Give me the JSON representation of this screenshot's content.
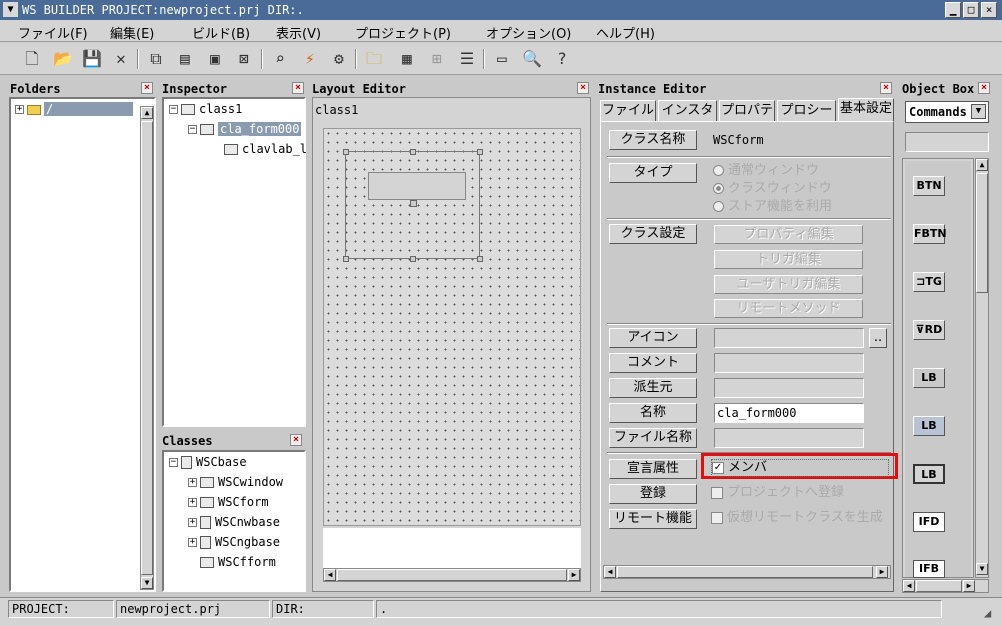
{
  "window": {
    "title": "WS BUILDER PROJECT:newproject.prj DIR:."
  },
  "menu": [
    "ファイル(F)",
    "編集(E)",
    "ビルド(B)",
    "表示(V)",
    "プロジェクト(P)",
    "オプション(O)",
    "ヘルプ(H)"
  ],
  "folders": {
    "title": "Folders",
    "root": "/"
  },
  "inspector": {
    "title": "Inspector",
    "items": [
      "class1",
      "cla_form000",
      "clavlab_l"
    ]
  },
  "classes": {
    "title": "Classes",
    "items": [
      "WSCbase",
      "WSCwindow",
      "WSCform",
      "WSCnwbase",
      "WSCngbase",
      "WSCfform"
    ]
  },
  "layout": {
    "title": "Layout Editor",
    "class_label": "class1"
  },
  "instance": {
    "title": "Instance Editor",
    "tabs": [
      "ファイル",
      "インスタ",
      "プロパテ",
      "プロシー",
      "基本設定"
    ],
    "class_name_label": "クラス名称",
    "class_name_value": "WSCform",
    "type_label": "タイプ",
    "type_options": [
      "通常ウィンドウ",
      "クラスウィンドウ",
      "ストア機能を利用"
    ],
    "type_selected": "クラスウィンドウ",
    "class_settings_label": "クラス設定",
    "class_settings_buttons": [
      "プロパティ編集",
      "トリガ編集",
      "ユーザトリガ編集",
      "リモートメソッド"
    ],
    "icon_label": "アイコン",
    "icon_btn": "..",
    "comment_label": "コメント",
    "derived_label": "派生元",
    "name_label": "名称",
    "name_value": "cla_form000",
    "filename_label": "ファイル名称",
    "decl_label": "宣言属性",
    "decl_check": "メンバ",
    "register_label": "登録",
    "register_check": "プロジェクトへ登録",
    "remote_label": "リモート機能",
    "remote_check": "仮想リモートクラスを生成"
  },
  "objectbox": {
    "title": "Object Box",
    "category": "Commands",
    "items": [
      "BTN",
      "FBTN",
      "TG",
      "RD",
      "LB",
      "LB",
      "LB",
      "IFD",
      "IFB"
    ]
  },
  "status": {
    "project_label": "PROJECT:",
    "project_value": "newproject.prj",
    "dir_label": "DIR:",
    "dir_value": "."
  }
}
